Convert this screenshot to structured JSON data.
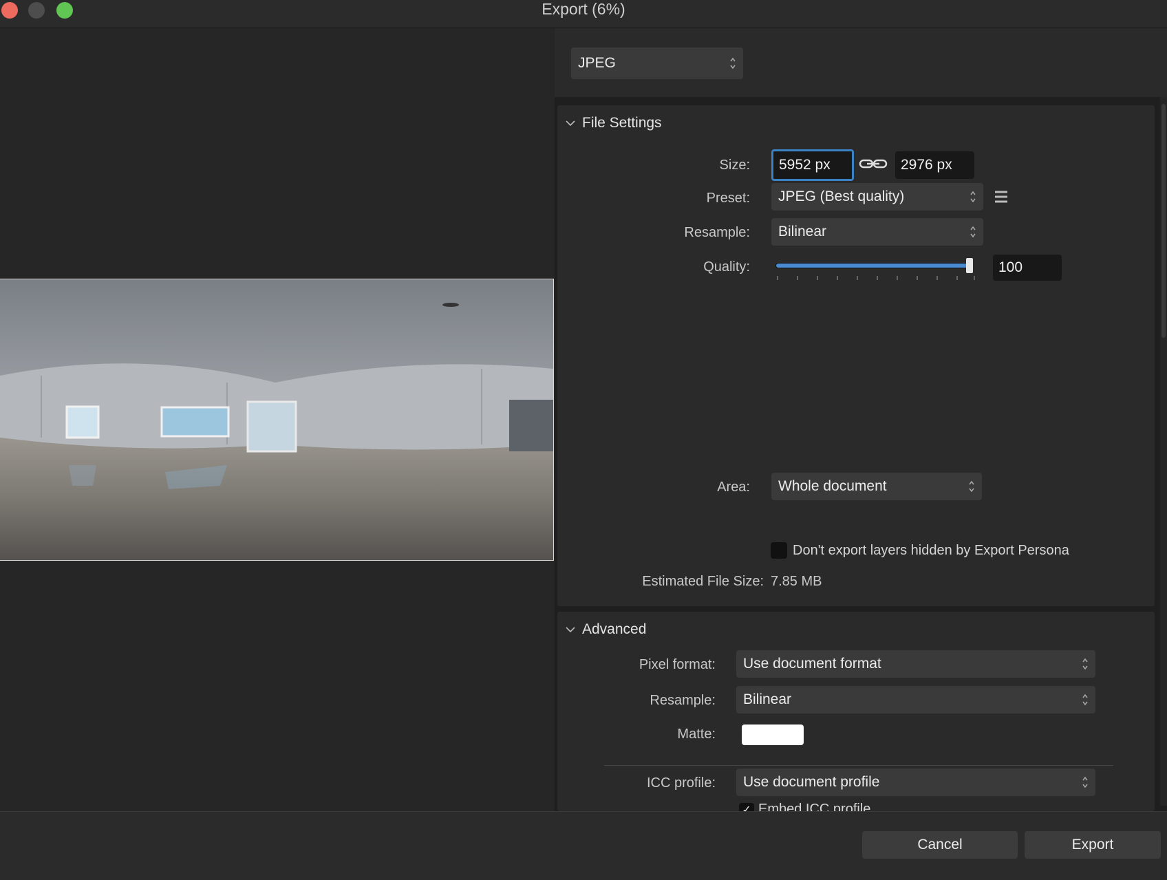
{
  "window": {
    "title": "Export (6%)",
    "traffic_lights": [
      {
        "name": "close-window-button",
        "color": "#ed6a5e"
      },
      {
        "name": "minimize-window-button",
        "color": "#4d4d4d"
      },
      {
        "name": "zoom-window-button",
        "color": "#61c554"
      }
    ]
  },
  "format": {
    "selected": "JPEG"
  },
  "file_settings": {
    "title": "File Settings",
    "size_label": "Size:",
    "width": "5952 px",
    "height": "2976 px",
    "preset_label": "Preset:",
    "preset": "JPEG (Best quality)",
    "resample_label": "Resample:",
    "resample": "Bilinear",
    "quality_label": "Quality:",
    "quality": "100",
    "quality_fraction": 1.0,
    "area_label": "Area:",
    "area": "Whole document",
    "hidden_layers_checkbox": "Don't export layers hidden by Export Persona",
    "hidden_layers_checked": false,
    "estimated_label": "Estimated File Size:",
    "estimated_value": "7.85 MB"
  },
  "advanced": {
    "title": "Advanced",
    "pixel_format_label": "Pixel format:",
    "pixel_format": "Use document format",
    "resample_label": "Resample:",
    "resample": "Bilinear",
    "matte_label": "Matte:",
    "matte_color": "#ffffff",
    "icc_label": "ICC profile:",
    "icc": "Use document profile",
    "embed_icc": "Embed ICC profile",
    "embed_icc_checked": true
  },
  "buttons": {
    "cancel": "Cancel",
    "export": "Export"
  },
  "colors": {
    "focus": "#3b82c4",
    "slider": "#4a8ad0"
  }
}
